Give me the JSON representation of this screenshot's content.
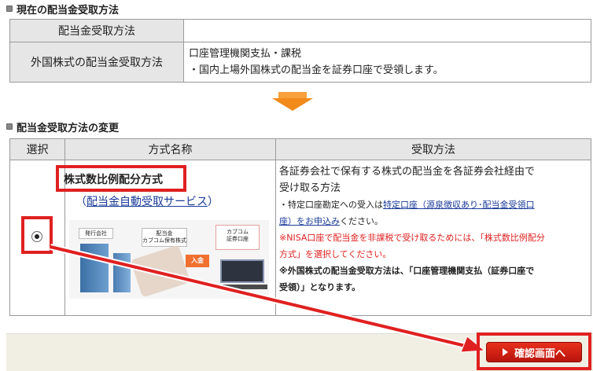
{
  "current_section": {
    "title": "現在の配当金受取方法",
    "rows": [
      {
        "label": "配当金受取方法",
        "value_lines": [
          ""
        ]
      },
      {
        "label": "外国株式の配当金受取方法",
        "value_lines": [
          "口座管理機関支払・課税",
          "・国内上場外国株式の配当金を証券口座で受領します。"
        ]
      }
    ]
  },
  "change_section": {
    "title": "配当金受取方法の変更",
    "headers": {
      "select": "選択",
      "method_name": "方式名称",
      "receive_method": "受取方法"
    },
    "option": {
      "name": "株式数比例配分方式",
      "service_open": "（",
      "service_link": "配当金自動受取サービス",
      "service_close": "）",
      "illustration": {
        "issuer": "発行会社",
        "dividend_line1": "配当金",
        "dividend_line2": "カブコム保有株式",
        "deposit": "入金",
        "broker_line1": "カブコム",
        "broker_line2": "証券口座"
      },
      "desc_line1": "各証券会社で保有する株式の配当金を各証券会社経由で",
      "desc_line2": "受け取る方法",
      "note1_prefix": "・特定口座勘定への受入は",
      "note1_link_a": "特定口座（源泉徴収あり･配当金受領口",
      "note1_link_b": "座）をお申込み",
      "note1_suffix": "ください。",
      "note2_line1": "※NISA口座で配当金を非課税で受け取るためには、「株式数比例配分",
      "note2_line2": "方式」を選択してください。",
      "note3_line1": "※外国株式の配当金受取方法は、「口座管理機関支払（証券口座で",
      "note3_line2": "受領）」となります。"
    }
  },
  "footer": {
    "confirm_label": "確認画面へ"
  },
  "colors": {
    "highlight": "#e02020",
    "header_bg": "#e6e6e6",
    "arrow": "#f28a1a",
    "footer_bg": "#f1efe4",
    "link": "#1a3a99"
  }
}
